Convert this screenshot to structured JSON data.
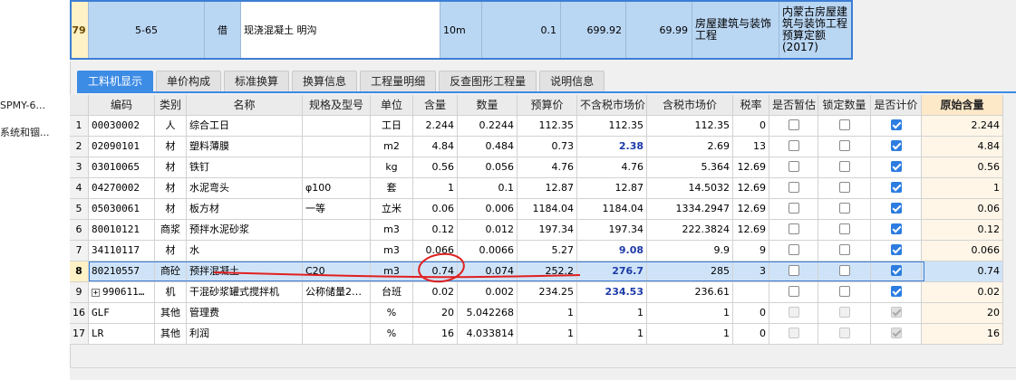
{
  "left_panel": {
    "items": [
      "SPMY-6...",
      "系统和锢..."
    ]
  },
  "top_row": {
    "num": "79",
    "code": "5-65",
    "type": "借",
    "name": "现浇混凝土 明沟",
    "unit": "10m",
    "qty": "0.1",
    "price": "699.92",
    "total": "69.99",
    "category": "房屋建筑与装饰工程",
    "quota": "内蒙古房屋建筑与装饰工程预算定额(2017)"
  },
  "tabs": [
    "工料机显示",
    "单价构成",
    "标准换算",
    "换算信息",
    "工程量明细",
    "反查图形工程量",
    "说明信息"
  ],
  "active_tab": 0,
  "table": {
    "headers": [
      "",
      "编码",
      "类别",
      "名称",
      "规格及型号",
      "单位",
      "含量",
      "数量",
      "预算价",
      "不含税市场价",
      "含税市场价",
      "税率",
      "是否暂估",
      "锁定数量",
      "是否计价",
      "原始含量"
    ],
    "rows": [
      {
        "n": "1",
        "code": "00030002",
        "cat": "人",
        "name": "综合工日",
        "spec": "",
        "unit": "工日",
        "content": "2.244",
        "qty": "0.2244",
        "budget": "112.35",
        "market": "112.35",
        "market_tax": "112.35",
        "rate": "0",
        "cb": [
          false,
          false,
          true
        ],
        "orig": "2.244"
      },
      {
        "n": "2",
        "code": "02090101",
        "cat": "材",
        "name": "塑料薄膜",
        "spec": "",
        "unit": "m2",
        "content": "4.84",
        "qty": "0.484",
        "budget": "0.73",
        "market": "2.38",
        "market_blue": true,
        "market_tax": "2.69",
        "rate": "13",
        "cb": [
          false,
          false,
          true
        ],
        "orig": "4.84"
      },
      {
        "n": "3",
        "code": "03010065",
        "cat": "材",
        "name": "铁钉",
        "spec": "",
        "unit": "kg",
        "content": "0.56",
        "qty": "0.056",
        "budget": "4.76",
        "market": "4.76",
        "market_tax": "5.364",
        "rate": "12.69",
        "cb": [
          false,
          false,
          true
        ],
        "orig": "0.56"
      },
      {
        "n": "4",
        "code": "04270002",
        "cat": "材",
        "name": "水泥弯头",
        "spec": "φ100",
        "unit": "套",
        "content": "1",
        "qty": "0.1",
        "budget": "12.87",
        "market": "12.87",
        "market_tax": "14.5032",
        "rate": "12.69",
        "cb": [
          false,
          false,
          true
        ],
        "orig": "1"
      },
      {
        "n": "5",
        "code": "05030061",
        "cat": "材",
        "name": "板方材",
        "spec": "一等",
        "unit": "立米",
        "content": "0.06",
        "qty": "0.006",
        "budget": "1184.04",
        "market": "1184.04",
        "market_tax": "1334.2947",
        "rate": "12.69",
        "cb": [
          false,
          false,
          true
        ],
        "orig": "0.06"
      },
      {
        "n": "6",
        "code": "80010121",
        "cat": "商浆",
        "name": "预拌水泥砂浆",
        "spec": "",
        "unit": "m3",
        "content": "0.12",
        "qty": "0.012",
        "budget": "197.34",
        "market": "197.34",
        "market_tax": "222.3824",
        "rate": "12.69",
        "cb": [
          false,
          false,
          true
        ],
        "orig": "0.12"
      },
      {
        "n": "7",
        "code": "34110117",
        "cat": "材",
        "name": "水",
        "spec": "",
        "unit": "m3",
        "content": "0.066",
        "qty": "0.0066",
        "budget": "5.27",
        "market": "9.08",
        "market_blue": true,
        "market_tax": "9.9",
        "rate": "9",
        "cb": [
          false,
          false,
          true
        ],
        "orig": "0.066"
      },
      {
        "n": "8",
        "code": "80210557",
        "cat": "商砼",
        "name": "预拌混凝土",
        "spec": "C20",
        "unit": "m3",
        "content": "0.74",
        "qty": "0.074",
        "budget": "252.2",
        "market": "276.7",
        "market_blue": true,
        "market_tax": "285",
        "rate": "3",
        "cb": [
          false,
          false,
          true
        ],
        "orig": "0.74",
        "selected": true
      },
      {
        "n": "9",
        "code": "990611…",
        "cat": "机",
        "name": "干混砂浆罐式搅拌机",
        "spec": "公称储量2…",
        "unit": "台班",
        "content": "0.02",
        "qty": "0.002",
        "budget": "234.25",
        "market": "234.53",
        "market_blue": true,
        "market_tax": "236.61",
        "rate": "",
        "cb": [
          false,
          false,
          true
        ],
        "orig": "0.02",
        "expand": true
      },
      {
        "n": "16",
        "code": "GLF",
        "cat": "其他",
        "name": "管理费",
        "spec": "",
        "unit": "%",
        "content": "20",
        "qty": "5.042268",
        "budget": "1",
        "market": "1",
        "market_tax": "1",
        "rate": "0",
        "cb": [
          false,
          false,
          true
        ],
        "cb_disabled": true,
        "orig": "20"
      },
      {
        "n": "17",
        "code": "LR",
        "cat": "其他",
        "name": "利润",
        "spec": "",
        "unit": "%",
        "content": "16",
        "qty": "4.033814",
        "budget": "1",
        "market": "1",
        "market_tax": "1",
        "rate": "0",
        "cb": [
          false,
          false,
          true
        ],
        "cb_disabled": true,
        "orig": "16"
      }
    ]
  },
  "colors": {
    "accent": "#3c8be4",
    "selected_row": "#cfe3f8",
    "blue_value": "#1d3ba8",
    "annotation": "#e02020"
  }
}
